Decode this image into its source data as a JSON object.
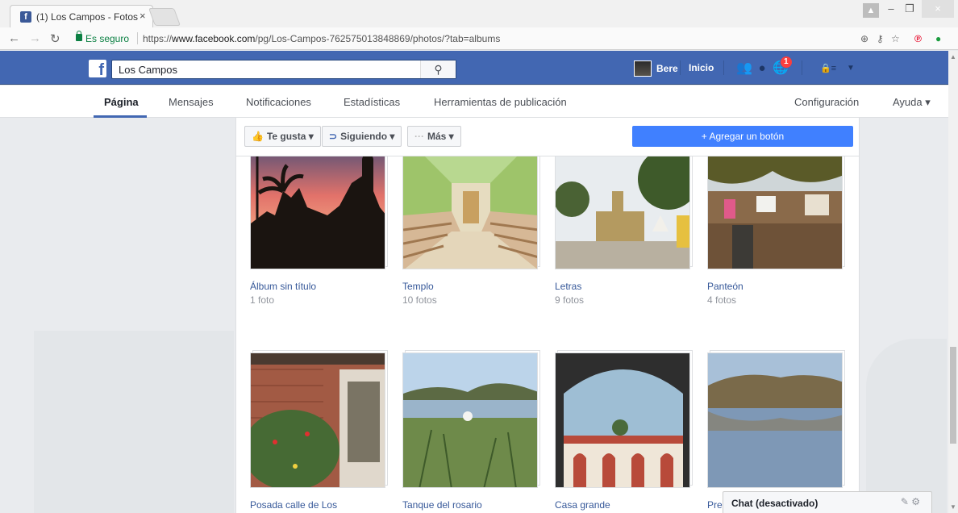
{
  "browser": {
    "tab_title": "(1) Los Campos - Fotos",
    "tab_close": "×",
    "secure_label": "Es seguro",
    "url_prefix": "https://",
    "url_host": "www.facebook.com",
    "url_path": "/pg/Los-Campos-762575013848869/photos/?tab=albums"
  },
  "fb": {
    "logo": "f",
    "search_value": "Los Campos",
    "user_name": "Bere",
    "home_label": "Inicio",
    "notif_count": "1"
  },
  "page_nav": {
    "items": [
      "Página",
      "Mensajes",
      "Notificaciones",
      "Estadísticas",
      "Herramientas de publicación"
    ],
    "right": [
      "Configuración",
      "Ayuda ▾"
    ]
  },
  "actions": {
    "like": "Te gusta ▾",
    "following": "Siguiendo ▾",
    "more": "Más ▾",
    "add_button": "+ Agregar un botón"
  },
  "albums": [
    {
      "title": "Álbum sin título",
      "count": "1 foto"
    },
    {
      "title": "Templo",
      "count": "10 fotos"
    },
    {
      "title": "Letras",
      "count": "9 fotos"
    },
    {
      "title": "Panteón",
      "count": "4 fotos"
    },
    {
      "title": "Posada calle de Los",
      "count": ""
    },
    {
      "title": "Tanque del rosario",
      "count": ""
    },
    {
      "title": "Casa grande",
      "count": ""
    },
    {
      "title": "Pre",
      "count": ""
    }
  ],
  "chat": {
    "label": "Chat (desactivado)"
  },
  "colors": {
    "fb_blue": "#4267b2",
    "link": "#365899",
    "cta": "#4080ff"
  }
}
